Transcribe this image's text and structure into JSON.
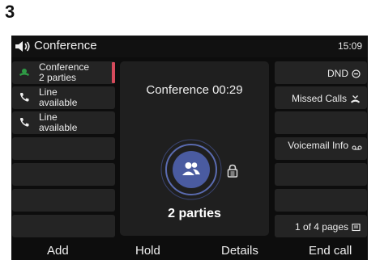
{
  "step_number": "3",
  "status_bar": {
    "title": "Conference",
    "time": "15:09",
    "icon": "speaker-icon"
  },
  "line_keys": [
    {
      "line1": "Conference",
      "line2": "2 parties",
      "icon": "conference-icon",
      "active": true
    },
    {
      "line1": "Line",
      "line2": "available",
      "icon": "phone-handset-icon",
      "active": false
    },
    {
      "line1": "Line",
      "line2": "available",
      "icon": "phone-handset-icon",
      "active": false
    },
    {
      "line1": "",
      "line2": ""
    },
    {
      "line1": "",
      "line2": ""
    },
    {
      "line1": "",
      "line2": ""
    },
    {
      "line1": "",
      "line2": ""
    }
  ],
  "call_panel": {
    "title": "Conference 00:29",
    "parties": "2 parties",
    "avatar_icon": "group-icon",
    "secure_icon": "lock-icon",
    "avatar_color": "#4a5ba0"
  },
  "right_keys": [
    {
      "label": "DND",
      "icon": "dnd-icon"
    },
    {
      "label": "Missed Calls",
      "icon": "missed-call-icon"
    },
    {
      "label": ""
    },
    {
      "label": "Voicemail Info",
      "icon": "voicemail-icon"
    },
    {
      "label": ""
    },
    {
      "label": ""
    },
    {
      "label": "1 of 4 pages",
      "icon": "pages-icon"
    }
  ],
  "softkeys": [
    "Add",
    "Hold",
    "Details",
    "End call"
  ],
  "colors": {
    "active_indicator": "#d64a5b",
    "conference_icon": "#2f9a45"
  }
}
